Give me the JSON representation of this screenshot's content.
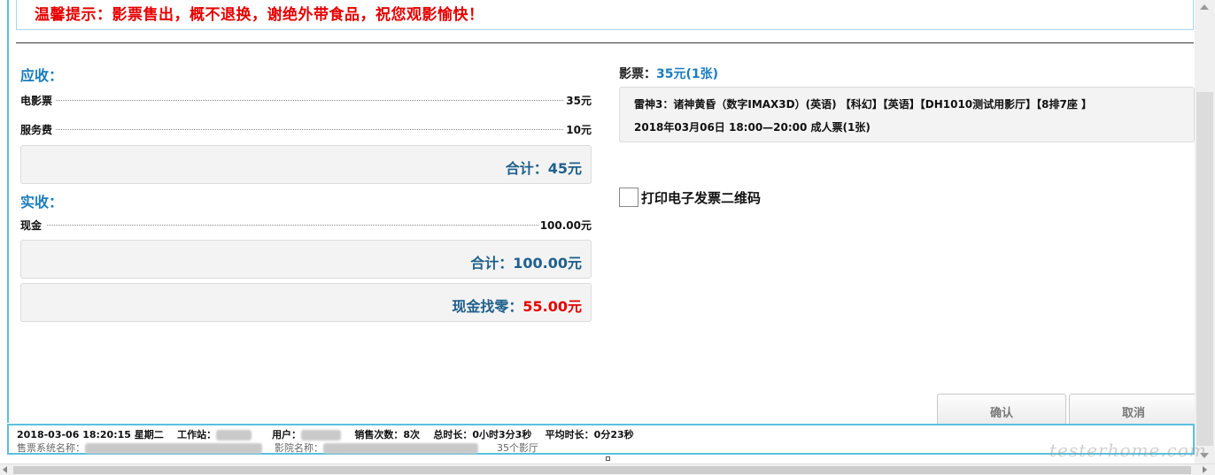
{
  "notice": {
    "text": "温馨提示：影票售出，概不退换，谢绝外带食品，祝您观影愉快！"
  },
  "receivable": {
    "title": "应收：",
    "items": [
      {
        "label": "电影票",
        "value": "35元"
      },
      {
        "label": "服务费",
        "value": "10元"
      }
    ],
    "total_label": "合计：",
    "total_value": "45元"
  },
  "received": {
    "title": "实收：",
    "items": [
      {
        "label": "现金",
        "value": "100.00元"
      }
    ],
    "total_label": "合计：",
    "total_value": "100.00元",
    "change_label": "现金找零：",
    "change_value": "55.00元"
  },
  "ticket": {
    "label": "影票：",
    "price_summary": "35元(1张)",
    "line1": "雷神3：诸神黄昏（数字IMAX3D）(英语)   【科幻】【英语】【DH1010测试用影厅】【8排7座 】",
    "line2": "2018年03月06日   18:00—20:00        成人票(1张)"
  },
  "print_option": {
    "label": "打印电子发票二维码",
    "checked": false
  },
  "buttons": {
    "confirm": "确认",
    "cancel": "取消"
  },
  "status_bar": {
    "datetime": "2018-03-06 18:20:15 星期二",
    "workstation_label": "工作站：",
    "user_label": "用户：",
    "sales_count": "销售次数：8次",
    "total_duration": "总时长：0小时3分3秒",
    "avg_duration": "平均时长：0分23秒",
    "system_name_label": "售票系统名称：",
    "cinema_name_label": "影院名称：",
    "hall_count": "35个影厅"
  },
  "watermark": "testerhome.com",
  "colors": {
    "accent": "#1a7dbd",
    "alert": "#e60000",
    "frame": "#5bc0de",
    "panel": "#f3f3f3"
  }
}
